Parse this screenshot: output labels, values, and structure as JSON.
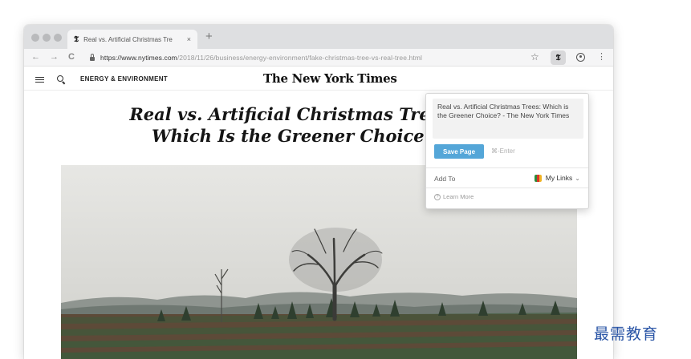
{
  "browser": {
    "tab": {
      "favicon": "𝕿",
      "title": "Real vs. Artificial Christmas Tre",
      "close": "×"
    },
    "new_tab": "+",
    "nav": {
      "back": "←",
      "forward": "→",
      "reload": "C"
    },
    "url_domain": "https://www.nytimes.com",
    "url_path": "/2018/11/26/business/energy-environment/fake-christmas-tree-vs-real-tree.html",
    "bookmark": "☆",
    "extension_label": "𝕿",
    "menu": "⋮"
  },
  "site": {
    "section": "ENERGY & ENVIRONMENT",
    "masthead": "The New York Times",
    "headline_line1": "Real vs. Artificial Christmas Trees:",
    "headline_line2": "Which Is the Greener Choice?",
    "hero_image": "bare-tree-over-christmas-tree-farm"
  },
  "popup": {
    "title_text": "Real vs. Artificial Christmas Trees: Which is the Greener Choice? - The New York Times",
    "save_label": "Save Page",
    "shortcut_hint": "⌘-Enter",
    "add_to_label": "Add To",
    "collection_name": "My Links",
    "collection_chevron": "⌄",
    "learn_more": "Learn More",
    "accent": "#54a6d8"
  },
  "watermark": "最需教育"
}
